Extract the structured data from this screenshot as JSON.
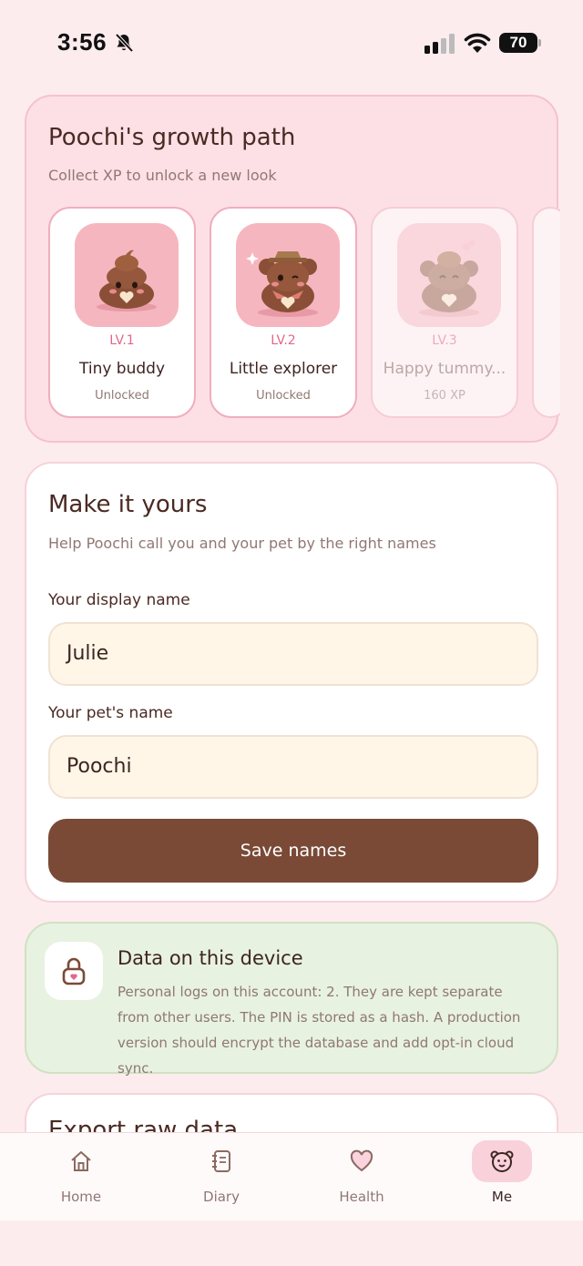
{
  "status_bar": {
    "time": "3:56",
    "battery": "70",
    "icons": [
      "bell-slash-icon",
      "signal-icon",
      "wifi-icon",
      "battery-icon"
    ]
  },
  "growth": {
    "title": "Poochi's growth path",
    "subtitle": "Collect XP to unlock a new look",
    "levels": [
      {
        "level": "LV.1",
        "name": "Tiny buddy",
        "status": "Unlocked"
      },
      {
        "level": "LV.2",
        "name": "Little explorer",
        "status": "Unlocked"
      },
      {
        "level": "LV.3",
        "name": "Happy tummy...",
        "status": "160 XP"
      }
    ]
  },
  "names": {
    "title": "Make it yours",
    "subtitle": "Help Poochi call you and your pet by the right names",
    "display_label": "Your display name",
    "display_value": "Julie",
    "pet_label": "Your pet's name",
    "pet_value": "Poochi",
    "save_label": "Save names"
  },
  "data_card": {
    "title": "Data on this device",
    "body": "Personal logs on this account: 2. They are kept separate from other users. The PIN is stored as a hash. A production version should encrypt the database and add opt-in cloud sync.",
    "icon": "lock-icon"
  },
  "export_card": {
    "title": "Export raw data"
  },
  "tabs": [
    {
      "label": "Home",
      "icon": "home-icon"
    },
    {
      "label": "Diary",
      "icon": "diary-icon"
    },
    {
      "label": "Health",
      "icon": "heart-icon"
    },
    {
      "label": "Me",
      "icon": "bear-face-icon",
      "active": true
    }
  ],
  "colors": {
    "background": "#fdecee",
    "accent_brown": "#7a4a37",
    "accent_pink": "#e2678a",
    "data_green": "#e8f2e0"
  }
}
